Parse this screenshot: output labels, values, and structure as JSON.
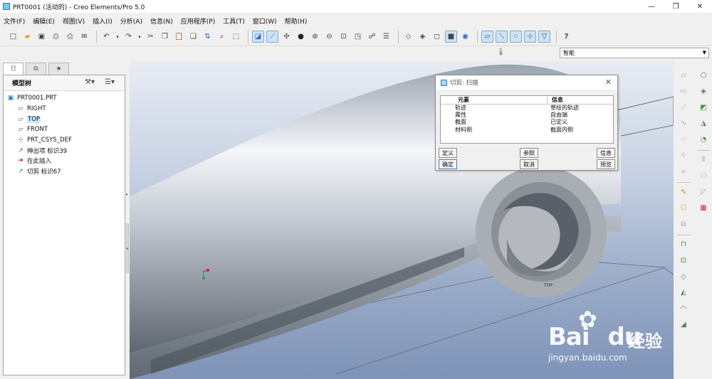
{
  "window": {
    "title": "PRT0001 (活动的) - Creo Elements/Pro 5.0",
    "controls": [
      "—",
      "❐",
      "✕"
    ]
  },
  "menubar": [
    "文件(F)",
    "编辑(E)",
    "视图(V)",
    "插入(I)",
    "分析(A)",
    "信息(N)",
    "应用程序(P)",
    "工具(T)",
    "窗口(W)",
    "帮助(H)"
  ],
  "toolbar": {
    "icons": [
      "new-icon",
      "open-icon",
      "save-icon",
      "print-icon",
      "print-preview-icon",
      "email-icon",
      "sep",
      "undo-icon",
      "undo-dropdown-icon",
      "redo-icon",
      "redo-dropdown-icon",
      "cut-icon",
      "copy-icon",
      "paste-icon",
      "paste-special-icon",
      "regenerate-icon",
      "find-icon",
      "select-box-icon",
      "sep",
      "repaint-icon",
      "spin-center-icon",
      "orient-mode-icon",
      "appearance-icon",
      "zoom-in-icon",
      "zoom-out-icon",
      "refit-icon",
      "reorient-icon",
      "saved-views-icon",
      "layers-icon",
      "sep",
      "wireframe-icon",
      "hidden-line-icon",
      "no-hidden-icon",
      "shading-icon",
      "enhanced-realism-icon",
      "sep",
      "datum-planes-icon",
      "datum-axes-icon",
      "datum-points-icon",
      "csys-icon",
      "annotations-icon",
      "sep",
      "context-help-icon"
    ]
  },
  "filter": {
    "value": "智能"
  },
  "left_panel": {
    "tabs": [
      "model-tree-tab",
      "layer-tree-tab",
      "favorites-tab"
    ],
    "header": "模型树",
    "tree": [
      {
        "label": "PRT0001.PRT",
        "icon": "part-icon",
        "indent": 0,
        "highlight": false
      },
      {
        "label": "RIGHT",
        "icon": "datum-plane-icon",
        "indent": 1,
        "highlight": false
      },
      {
        "label": "TOP",
        "icon": "datum-plane-icon",
        "indent": 1,
        "highlight": true
      },
      {
        "label": "FRONT",
        "icon": "datum-plane-icon",
        "indent": 1,
        "highlight": false
      },
      {
        "label": "PRT_CSYS_DEF",
        "icon": "csys-icon",
        "indent": 1,
        "highlight": false
      },
      {
        "label": "伸出项 标识39",
        "icon": "sweep-protrusion-icon",
        "indent": 1,
        "highlight": false
      },
      {
        "label": "在此插入",
        "icon": "insert-here-icon",
        "indent": 1,
        "highlight": false
      },
      {
        "label": "切剪 标识67",
        "icon": "sweep-cut-icon",
        "indent": 1,
        "highlight": false
      }
    ]
  },
  "dialog": {
    "title": "切剪: 扫描",
    "columns": [
      "元素",
      "信息"
    ],
    "rows": [
      [
        "轨迹",
        "草绘的轨迹"
      ],
      [
        "属性",
        "自由端"
      ],
      [
        "截面",
        "已定义"
      ],
      [
        "材料侧",
        "截面内侧"
      ]
    ],
    "buttons": {
      "define": "定义",
      "reference": "参照",
      "info": "信息",
      "ok": "确定",
      "cancel": "取消",
      "preview": "预览"
    }
  },
  "viewport": {
    "datum_label": "TOP"
  },
  "watermark": {
    "brand": "Bai",
    "brand2": "du",
    "cn": "经验",
    "url": "jingyan.baidu.com"
  }
}
